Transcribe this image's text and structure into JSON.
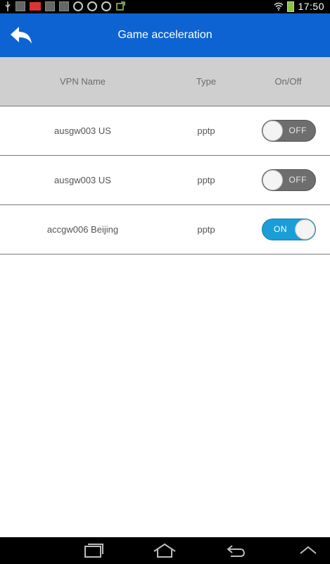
{
  "status_bar": {
    "time": "17:50",
    "icons": [
      "usb-icon",
      "notification-icon",
      "app-badge-icon",
      "image-icon",
      "image-icon",
      "sync-icon",
      "sync-icon",
      "sync-icon",
      "download-icon",
      "wifi-icon",
      "battery-icon"
    ]
  },
  "app_bar": {
    "title": "Game acceleration",
    "back_icon": "back-arrow-icon"
  },
  "table": {
    "headers": [
      "VPN Name",
      "Type",
      "On/Off"
    ],
    "rows": [
      {
        "name": "ausgw003 US",
        "type": "pptp",
        "toggle": "OFF"
      },
      {
        "name": "ausgw003 US",
        "type": "pptp",
        "toggle": "OFF"
      },
      {
        "name": "accgw006 Beijing",
        "type": "pptp",
        "toggle": "ON"
      }
    ]
  },
  "nav_bar": {
    "buttons": [
      "recent-apps-icon",
      "home-icon",
      "back-icon",
      "menu-up-icon"
    ]
  },
  "colors": {
    "app_bar": "#0d63d1",
    "header_bg": "#cfcfcf",
    "toggle_on": "#1a9ed9",
    "toggle_off": "#6e6e6e"
  }
}
